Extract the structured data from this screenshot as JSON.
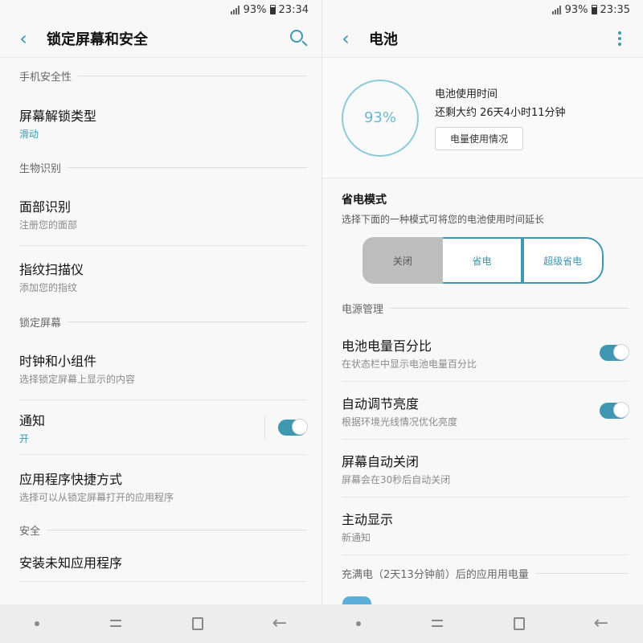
{
  "left": {
    "status": {
      "battery": "93%",
      "time": "23:34"
    },
    "title": "锁定屏幕和安全",
    "sections": [
      {
        "header": "手机安全性",
        "items": [
          {
            "main": "屏幕解锁类型",
            "sub": "滑动"
          }
        ]
      },
      {
        "header": "生物识别",
        "items": [
          {
            "main": "面部识别",
            "sub": "注册您的面部"
          },
          {
            "main": "指纹扫描仪",
            "sub": "添加您的指纹"
          }
        ]
      },
      {
        "header": "锁定屏幕",
        "items": [
          {
            "main": "时钟和小组件",
            "sub": "选择锁定屏幕上显示的内容"
          },
          {
            "main": "通知",
            "sub": "开"
          },
          {
            "main": "应用程序快捷方式",
            "sub": "选择可以从锁定屏幕打开的应用程序"
          }
        ]
      },
      {
        "header": "安全",
        "items": [
          {
            "main": "安装未知应用程序",
            "sub": ""
          }
        ]
      }
    ]
  },
  "right": {
    "status": {
      "battery": "93%",
      "time": "23:35"
    },
    "title": "电池",
    "battery_percent": "93%",
    "usage_label": "电池使用时间",
    "remaining": "还剩大约 26天4小时11分钟",
    "usage_button": "电量使用情况",
    "power_mode_title": "省电模式",
    "power_mode_desc": "选择下面的一种模式可将您的电池使用时间延长",
    "modes": [
      "关闭",
      "省电",
      "超级省电"
    ],
    "selected_mode": "关闭",
    "power_mgmt_header": "电源管理",
    "items": [
      {
        "main": "电池电量百分比",
        "sub": "在状态栏中显示电池电量百分比",
        "toggle": true
      },
      {
        "main": "自动调节亮度",
        "sub": "根据环境光线情况优化亮度",
        "toggle": true
      },
      {
        "main": "屏幕自动关闭",
        "sub": "屏幕会在30秒后自动关闭"
      },
      {
        "main": "主动显示",
        "sub": "新通知"
      }
    ],
    "apps_header": "充满电（2天13分钟前）后的应用用电量"
  },
  "colors": {
    "accent": "#3b97b3",
    "toggle_on": "#3f97b1"
  },
  "icons": [
    "back-icon",
    "search-icon",
    "more-icon",
    "signal-icon",
    "battery-icon"
  ]
}
